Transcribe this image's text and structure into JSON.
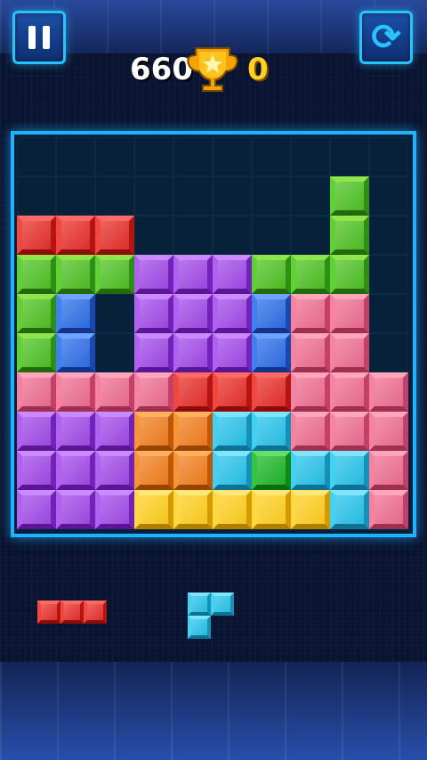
{
  "hud": {
    "score": "660",
    "best_score": "0",
    "pause_icon": "pause-icon",
    "restart_icon": "restart-icon",
    "trophy_icon": "trophy-icon"
  },
  "board": {
    "columns": 10,
    "rows": 10,
    "cells": [
      [
        "",
        "",
        "",
        "",
        "",
        "",
        "",
        "",
        "",
        ""
      ],
      [
        "",
        "",
        "",
        "",
        "",
        "",
        "",
        "",
        "green",
        ""
      ],
      [
        "red",
        "red",
        "red",
        "",
        "",
        "",
        "",
        "",
        "green",
        ""
      ],
      [
        "green",
        "green",
        "green",
        "purple",
        "purple",
        "purple",
        "green",
        "green",
        "green",
        ""
      ],
      [
        "green",
        "blue",
        "",
        "purple",
        "purple",
        "purple",
        "blue",
        "pink",
        "pink",
        ""
      ],
      [
        "green",
        "blue",
        "",
        "purple",
        "purple",
        "purple",
        "blue",
        "pink",
        "pink",
        ""
      ],
      [
        "pink",
        "pink",
        "pink",
        "pink",
        "red",
        "red",
        "red",
        "pink",
        "pink",
        "pink"
      ],
      [
        "purple",
        "purple",
        "purple",
        "orange",
        "orange",
        "cyan",
        "cyan",
        "pink",
        "pink",
        "pink"
      ],
      [
        "purple",
        "purple",
        "purple",
        "orange",
        "orange",
        "cyan",
        "dgreen",
        "cyan",
        "cyan",
        "pink"
      ],
      [
        "purple",
        "purple",
        "purple",
        "yellow",
        "yellow",
        "yellow",
        "yellow",
        "yellow",
        "cyan",
        "pink"
      ]
    ]
  },
  "tray": {
    "pieces": [
      {
        "color": "red",
        "cells": [
          [
            0,
            0
          ],
          [
            1,
            0
          ],
          [
            2,
            0
          ]
        ]
      },
      {
        "color": "cyan",
        "cells": [
          [
            0,
            0
          ],
          [
            1,
            0
          ],
          [
            0,
            1
          ]
        ]
      }
    ]
  }
}
